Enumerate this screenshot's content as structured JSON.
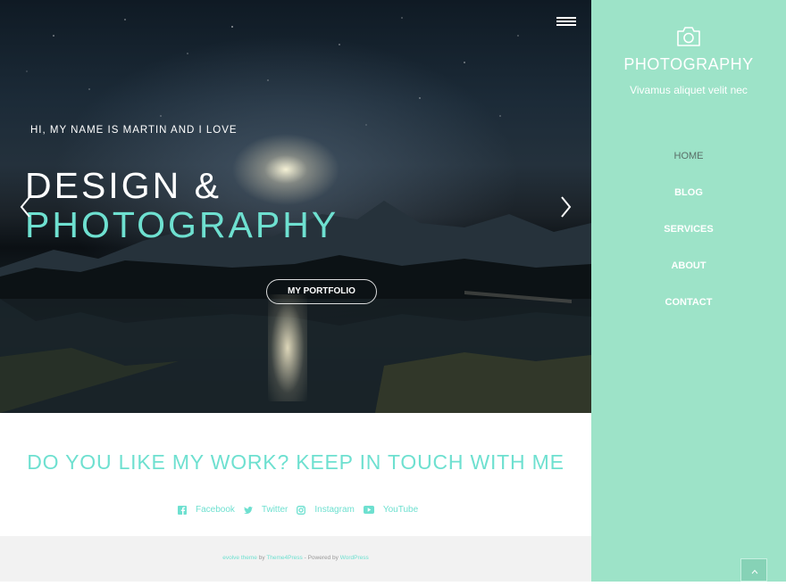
{
  "hero": {
    "intro": "HI, MY NAME IS MARTIN AND I LOVE",
    "headline_line1": "DESIGN &",
    "headline_line2": "PHOTOGRAPHY",
    "button_label": "MY PORTFOLIO",
    "accent_color": "#6ee0d0"
  },
  "contact": {
    "heading": "DO YOU LIKE MY WORK? KEEP IN TOUCH WITH ME",
    "social": [
      {
        "icon": "facebook-icon",
        "label": "Facebook"
      },
      {
        "icon": "twitter-icon",
        "label": "Twitter"
      },
      {
        "icon": "instagram-icon",
        "label": "Instagram"
      },
      {
        "icon": "youtube-icon",
        "label": "YouTube"
      }
    ]
  },
  "footer": {
    "theme_link": "evolve theme",
    "by_text": "by",
    "author_link": "Theme4Press",
    "separator": "-",
    "powered_text": "Powered by",
    "platform_link": "WordPress"
  },
  "sidebar": {
    "icon": "camera-icon",
    "title": "PHOTOGRAPHY",
    "tagline": "Vivamus aliquet velit nec",
    "nav": [
      "HOME",
      "BLOG",
      "SERVICES",
      "ABOUT",
      "CONTACT"
    ],
    "active_nav": "HOME",
    "background_color": "#9de3c8"
  }
}
